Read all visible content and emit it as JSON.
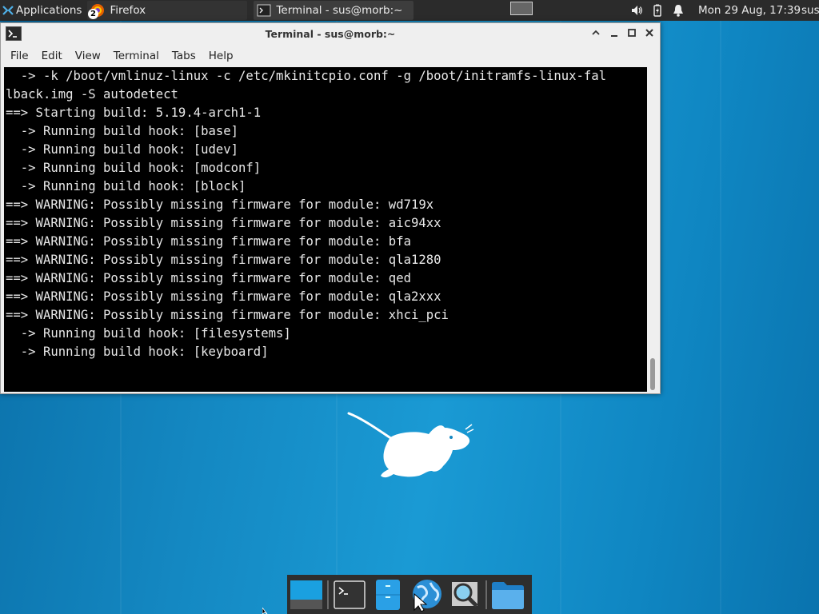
{
  "top_panel": {
    "applications_label": "Applications",
    "tasks": [
      {
        "label": "Firefox",
        "badge": "2",
        "icon": "firefox-icon"
      },
      {
        "label": "Terminal - sus@morb:~",
        "icon": "terminal-icon"
      }
    ],
    "tray_icons": [
      "volume-icon",
      "battery-icon",
      "notification-bell-icon"
    ],
    "clock": "Mon 29 Aug, 17:39",
    "user": "sus"
  },
  "terminal_window": {
    "title": "Terminal - sus@morb:~",
    "menu": [
      "File",
      "Edit",
      "View",
      "Terminal",
      "Tabs",
      "Help"
    ],
    "lines": [
      "  -> -k /boot/vmlinuz-linux -c /etc/mkinitcpio.conf -g /boot/initramfs-linux-fal",
      "lback.img -S autodetect",
      "==> Starting build: 5.19.4-arch1-1",
      "  -> Running build hook: [base]",
      "  -> Running build hook: [udev]",
      "  -> Running build hook: [modconf]",
      "  -> Running build hook: [block]",
      "==> WARNING: Possibly missing firmware for module: wd719x",
      "==> WARNING: Possibly missing firmware for module: aic94xx",
      "==> WARNING: Possibly missing firmware for module: bfa",
      "==> WARNING: Possibly missing firmware for module: qla1280",
      "==> WARNING: Possibly missing firmware for module: qed",
      "==> WARNING: Possibly missing firmware for module: qla2xxx",
      "==> WARNING: Possibly missing firmware for module: xhci_pci",
      "  -> Running build hook: [filesystems]",
      "  -> Running build hook: [keyboard]"
    ]
  },
  "dock": {
    "items": [
      "show-desktop-icon",
      "terminal-icon",
      "file-manager-icon",
      "web-browser-icon",
      "app-finder-icon",
      "folder-icon"
    ]
  },
  "colors": {
    "accent": "#1a9ad4",
    "panel": "#2b2b2b",
    "terminal_bg": "#000000"
  }
}
